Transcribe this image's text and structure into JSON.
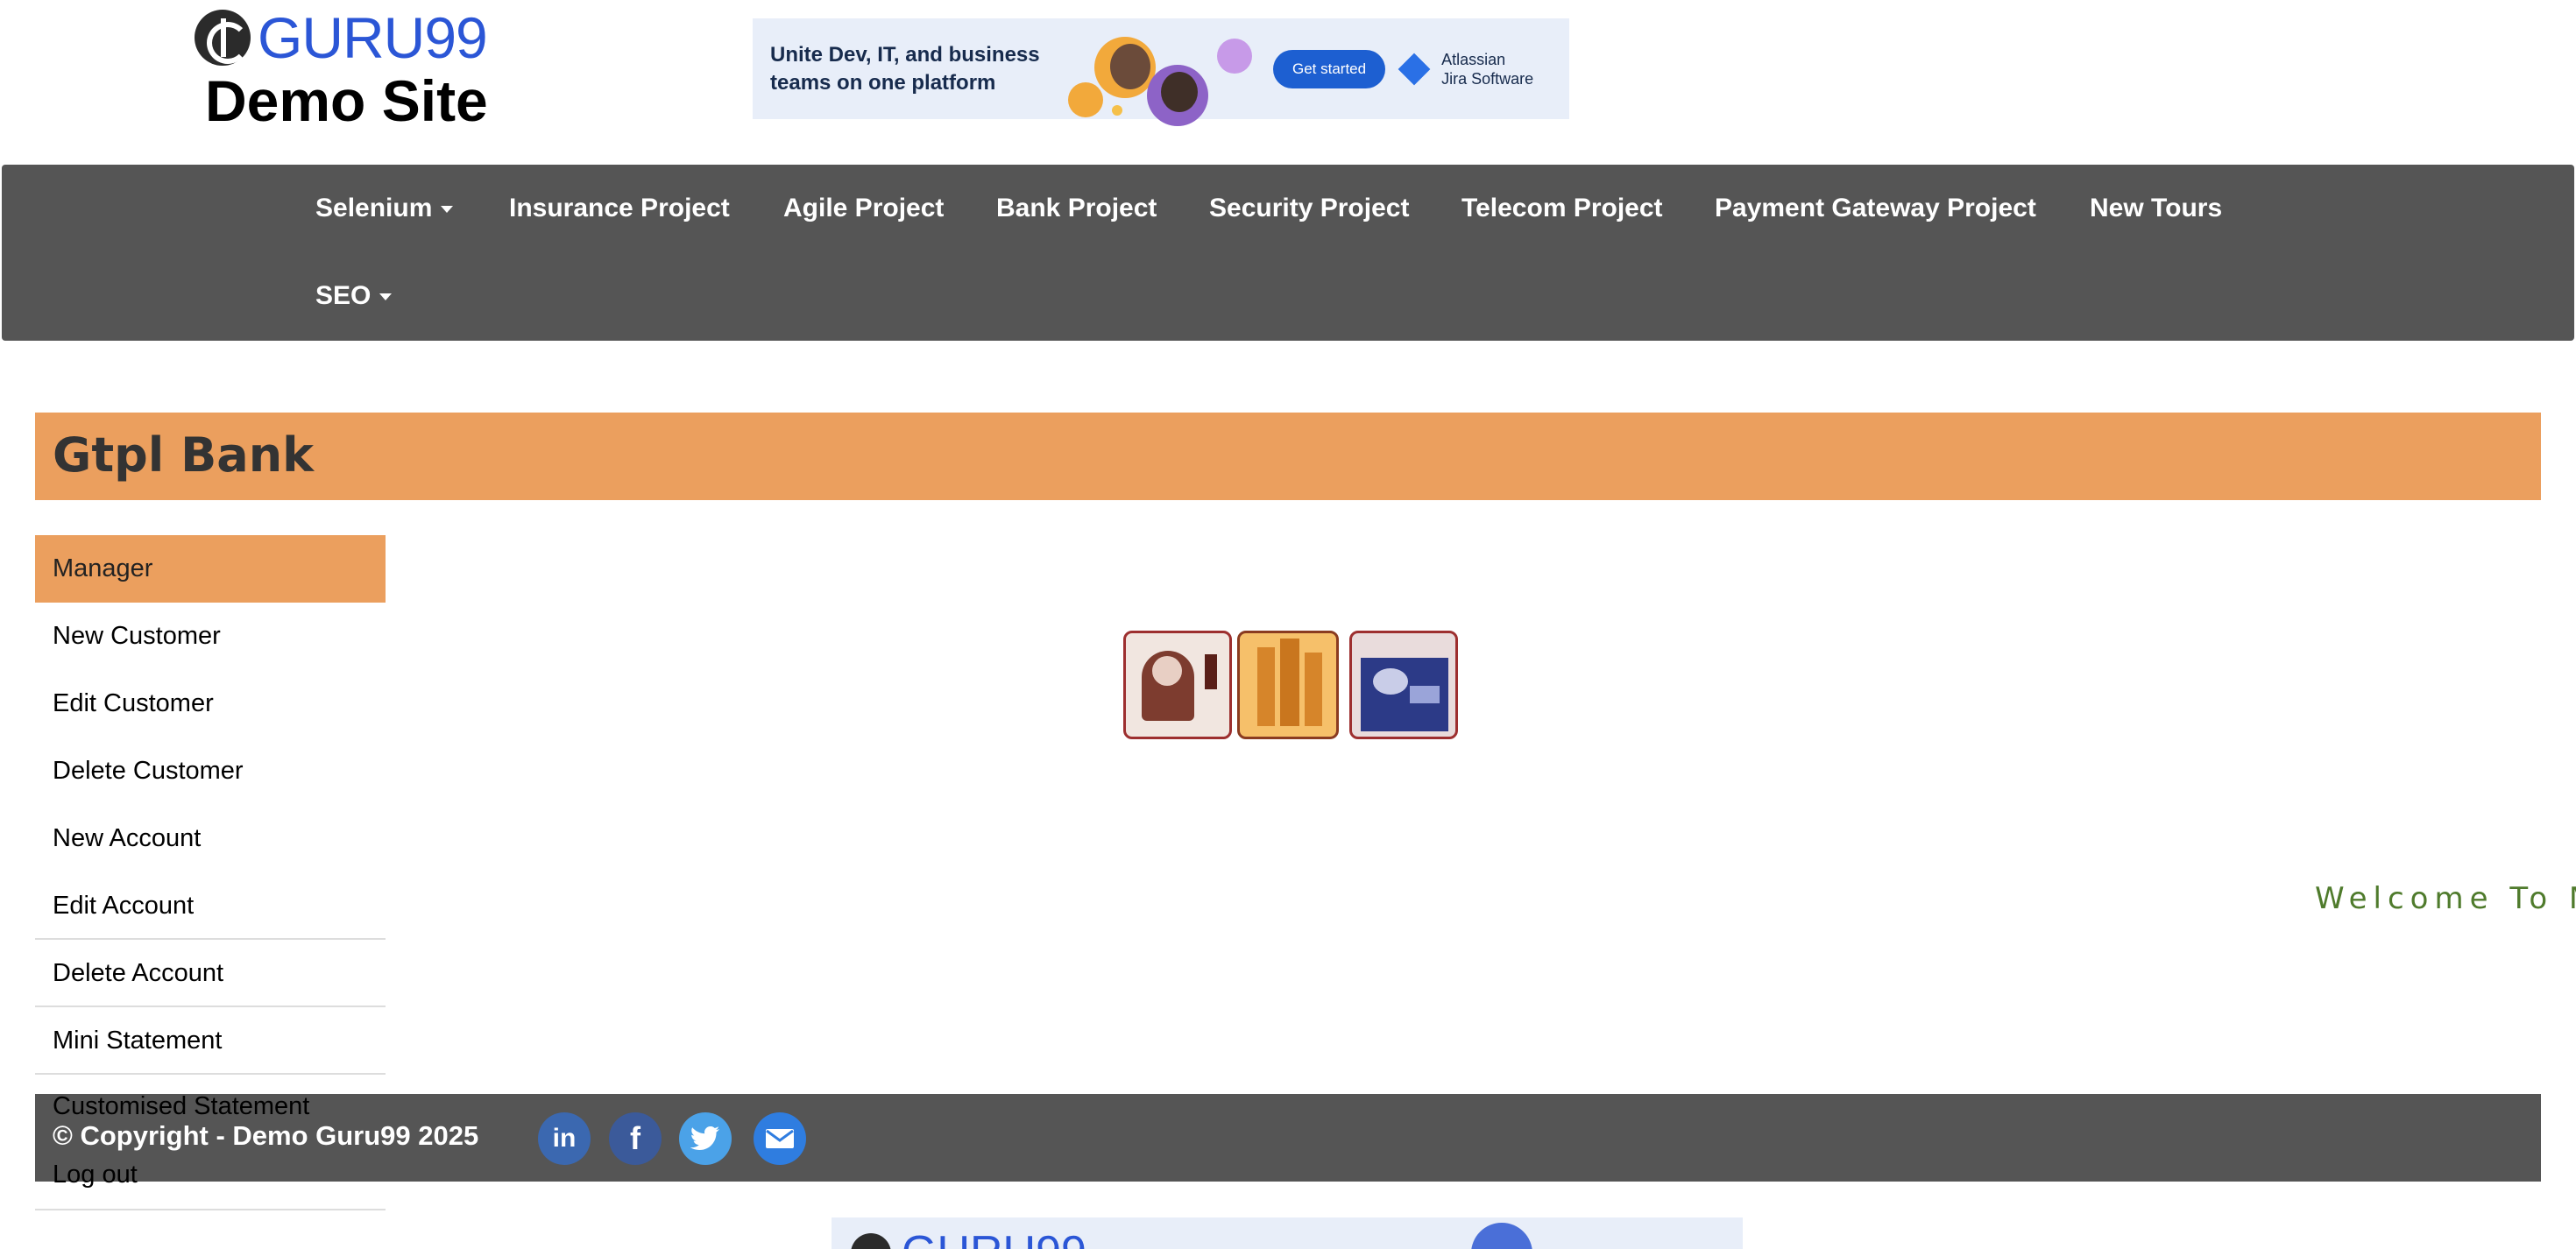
{
  "header": {
    "logo_text": "GURU99",
    "site_title": "Demo Site"
  },
  "ad": {
    "headline": "Unite Dev, IT, and business teams on one platform",
    "cta": "Get started",
    "brand_line1": "Atlassian",
    "brand_line2": "Jira Software"
  },
  "nav": {
    "items": [
      {
        "label": "Selenium",
        "dropdown": true
      },
      {
        "label": "Insurance Project",
        "dropdown": false
      },
      {
        "label": "Agile Project",
        "dropdown": false
      },
      {
        "label": "Bank Project",
        "dropdown": false
      },
      {
        "label": "Security Project",
        "dropdown": false
      },
      {
        "label": "Telecom Project",
        "dropdown": false
      },
      {
        "label": "Payment Gateway Project",
        "dropdown": false
      },
      {
        "label": "New Tours",
        "dropdown": false
      },
      {
        "label": "SEO",
        "dropdown": true
      }
    ]
  },
  "bank": {
    "title": "Gtpl Bank"
  },
  "menu": {
    "items": [
      {
        "label": "Manager",
        "active": true
      },
      {
        "label": "New Customer"
      },
      {
        "label": "Edit Customer"
      },
      {
        "label": "Delete Customer"
      },
      {
        "label": "New Account"
      },
      {
        "label": "Edit Account"
      },
      {
        "label": "Delete Account"
      },
      {
        "label": "Mini Statement"
      },
      {
        "label": "Customised Statement"
      },
      {
        "label": "Log out"
      }
    ]
  },
  "marquee": {
    "text": "Welcome To M"
  },
  "footer": {
    "copyright": "© Copyright - Demo Guru99 2025",
    "social": [
      {
        "name": "linkedin-icon",
        "glyph": "in",
        "color": "#3b68b0"
      },
      {
        "name": "facebook-icon",
        "glyph": "f",
        "color": "#3b5a9a"
      },
      {
        "name": "twitter-icon",
        "glyph": "t",
        "color": "#4ba2e8"
      },
      {
        "name": "email-icon",
        "glyph": "✉",
        "color": "#2f7de0"
      }
    ]
  },
  "colors": {
    "nav_bg": "#555555",
    "accent_orange": "#eb9f5e",
    "marquee_green": "#4f7b2c",
    "logo_blue": "#2b56d6"
  }
}
